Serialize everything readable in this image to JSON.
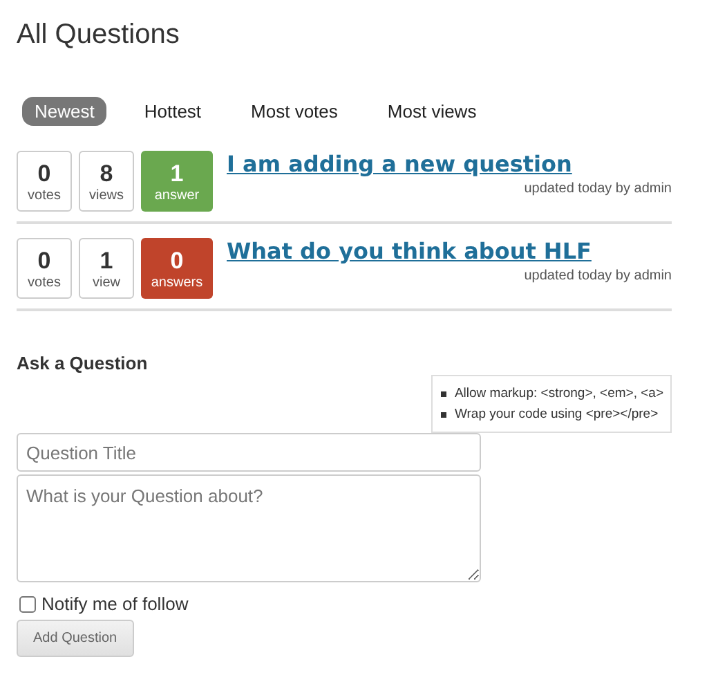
{
  "page_title": "All Questions",
  "tabs": [
    {
      "label": "Newest",
      "selected": true
    },
    {
      "label": "Hottest",
      "selected": false
    },
    {
      "label": "Most votes",
      "selected": false
    },
    {
      "label": "Most views",
      "selected": false
    }
  ],
  "questions": [
    {
      "votes": "0",
      "votes_label": "votes",
      "views": "8",
      "views_label": "views",
      "answers": "1",
      "answers_label": "answer",
      "answered": true,
      "title": "I am adding a new question",
      "meta": "updated today by admin"
    },
    {
      "votes": "0",
      "votes_label": "votes",
      "views": "1",
      "views_label": "view",
      "answers": "0",
      "answers_label": "answers",
      "answered": false,
      "title": "What do you think about HLF",
      "meta": "updated today by admin"
    }
  ],
  "ask": {
    "heading": "Ask a Question",
    "hints": [
      "Allow markup: <strong>, <em>, <a>",
      "Wrap your code using <pre></pre>"
    ],
    "title_field": {
      "placeholder": "Question Title"
    },
    "body_field": {
      "placeholder": "What is your Question about?"
    },
    "notify": {
      "label": "Notify me of follow",
      "checked": false
    },
    "submit": "Add Question"
  }
}
